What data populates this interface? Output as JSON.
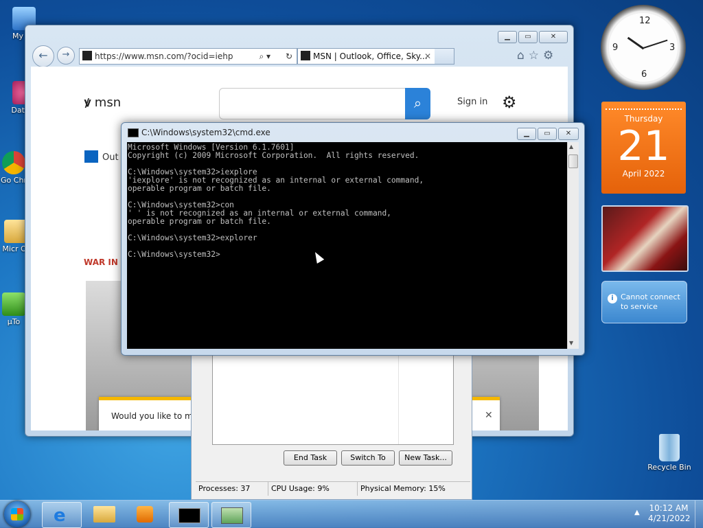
{
  "desktop_icons": [
    {
      "label": "My Co",
      "name": "my-computer"
    },
    {
      "label": "DataW",
      "name": "dataw"
    },
    {
      "label": "Go Chr",
      "name": "google-chrome"
    },
    {
      "label": "Micr Of",
      "name": "microsoft-office"
    },
    {
      "label": "µTo",
      "name": "utorrent"
    },
    {
      "label": "Recycle Bin",
      "name": "recycle-bin"
    }
  ],
  "ie": {
    "url": "https://www.msn.com/?ocid=iehp",
    "tab_title": "MSN | Outlook, Office, Sky...",
    "msn_logo": "msn",
    "sign_in": "Sign in",
    "outlook_label": "Out",
    "war_heading": "WAR IN U",
    "notify_text": "Would you like to mak"
  },
  "cmd": {
    "title": "C:\\Windows\\system32\\cmd.exe",
    "lines": [
      "Microsoft Windows [Version 6.1.7601]",
      "Copyright (c) 2009 Microsoft Corporation.  All rights reserved.",
      "",
      "C:\\Windows\\system32>iexplore",
      "'iexplore' is not recognized as an internal or external command,",
      "operable program or batch file.",
      "",
      "C:\\Windows\\system32>con",
      "' ' is not recognized as an internal or external command,",
      "operable program or batch file.",
      "",
      "C:\\Windows\\system32>explorer",
      "",
      "C:\\Windows\\system32>"
    ]
  },
  "taskmgr": {
    "end_task": "End Task",
    "switch_to": "Switch To",
    "new_task": "New Task...",
    "processes": "Processes: 37",
    "cpu": "CPU Usage: 9%",
    "memory": "Physical Memory: 15%"
  },
  "gadgets": {
    "weekday": "Thursday",
    "day": "21",
    "month_year": "April 2022",
    "weather_msg": "Cannot connect to service"
  },
  "tray": {
    "time": "10:12 AM",
    "date": "4/21/2022"
  }
}
